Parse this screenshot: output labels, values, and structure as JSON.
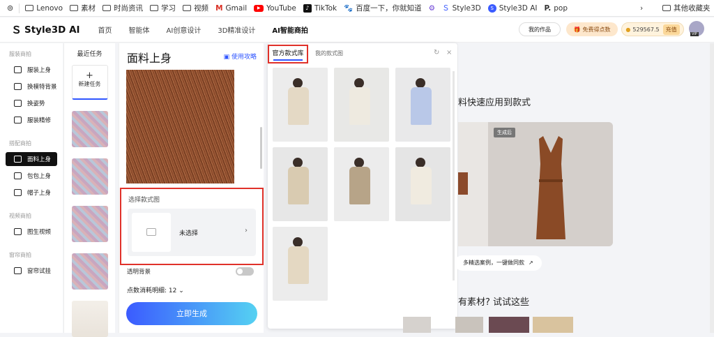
{
  "bookmarks": {
    "items": [
      "Lenovo",
      "素材",
      "时尚资讯",
      "学习",
      "视频",
      "Gmail",
      "YouTube",
      "TikTok",
      "百度一下，你就知道",
      "",
      "Style3D",
      "Style3D AI",
      "pop"
    ],
    "other": "其他收藏夹"
  },
  "header": {
    "brand": "Style3D AI",
    "nav": [
      "首页",
      "智能体",
      "AI创意设计",
      "3D精准设计",
      "AI智能商拍"
    ],
    "my_works": "我的作品",
    "free_points": "免费得点数",
    "points": "529567.5",
    "recharge": "充值",
    "vip": "VIP"
  },
  "sidebar": {
    "groups": [
      {
        "title": "服装商拍",
        "items": [
          "服装上身",
          "换模特背景",
          "换姿势",
          "服装精修"
        ]
      },
      {
        "title": "搭配商拍",
        "items": [
          "面料上身",
          "包包上身",
          "帽子上身"
        ]
      },
      {
        "title": "视频商拍",
        "items": [
          "图生视频"
        ]
      },
      {
        "title": "窗帘商拍",
        "items": [
          "窗帘试挂"
        ]
      }
    ]
  },
  "tasks": {
    "title": "最近任务",
    "new_plus": "+",
    "new_label": "新建任务"
  },
  "panel": {
    "title": "面料上身",
    "guide": "使用攻略",
    "select_label": "选择款式图",
    "not_selected": "未选择",
    "chevron": "›",
    "transparent_bg": "透明背景",
    "cost": "点数消耗明细: 12 ⌄",
    "generate": "立即生成"
  },
  "library": {
    "tab_official": "官方款式库",
    "tab_mine": "我的款式图",
    "refresh": "↻",
    "close": "×"
  },
  "right": {
    "title1": "料快速应用到款式",
    "badge": "生成后",
    "case_chip": "多精选案例，一键做同款",
    "arrow": "↗",
    "title2": "有素材? 试试这些"
  },
  "colors": {
    "accent": "#2f55ff",
    "highlight": "#e0312a"
  }
}
